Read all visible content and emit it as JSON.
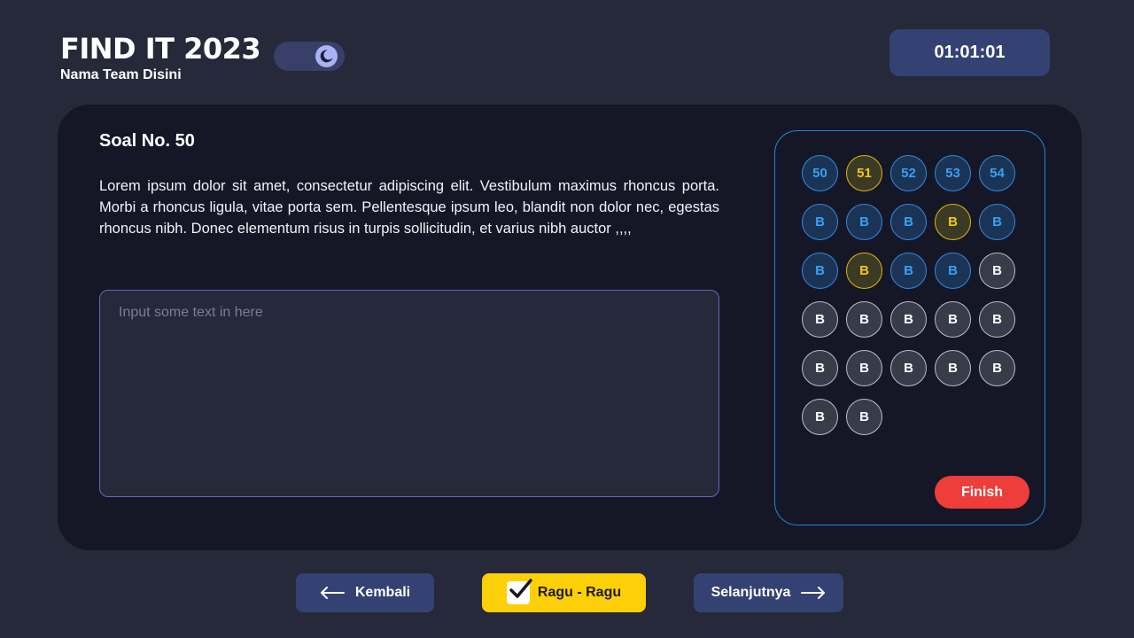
{
  "header": {
    "title": "FIND IT 2023",
    "team_name": "Nama Team Disini",
    "theme_toggle_icon": "moon-icon",
    "timer": "01:01:01"
  },
  "question": {
    "title": "Soal No. 50",
    "text": "Lorem ipsum dolor sit amet, consectetur adipiscing elit. Vestibulum maximus rhoncus porta. Morbi a rhoncus ligula, vitae porta sem. Pellentesque ipsum leo, blandit non dolor nec, egestas rhoncus nibh. Donec elementum risus in turpis sollicitudin, et varius nibh auctor ,,,,",
    "answer_placeholder": "Input some text in here",
    "answer_value": ""
  },
  "navigator": {
    "items": [
      {
        "label": "50",
        "state": "answered"
      },
      {
        "label": "51",
        "state": "doubt"
      },
      {
        "label": "52",
        "state": "answered"
      },
      {
        "label": "53",
        "state": "answered"
      },
      {
        "label": "54",
        "state": "answered"
      },
      {
        "label": "B",
        "state": "answered"
      },
      {
        "label": "B",
        "state": "answered"
      },
      {
        "label": "B",
        "state": "answered"
      },
      {
        "label": "B",
        "state": "doubt"
      },
      {
        "label": "B",
        "state": "answered"
      },
      {
        "label": "B",
        "state": "answered"
      },
      {
        "label": "B",
        "state": "doubt"
      },
      {
        "label": "B",
        "state": "answered"
      },
      {
        "label": "B",
        "state": "answered"
      },
      {
        "label": "B",
        "state": "empty"
      },
      {
        "label": "B",
        "state": "empty"
      },
      {
        "label": "B",
        "state": "empty"
      },
      {
        "label": "B",
        "state": "empty"
      },
      {
        "label": "B",
        "state": "empty"
      },
      {
        "label": "B",
        "state": "empty"
      },
      {
        "label": "B",
        "state": "empty"
      },
      {
        "label": "B",
        "state": "empty"
      },
      {
        "label": "B",
        "state": "empty"
      },
      {
        "label": "B",
        "state": "empty"
      },
      {
        "label": "B",
        "state": "empty"
      },
      {
        "label": "B",
        "state": "empty"
      },
      {
        "label": "B",
        "state": "empty"
      }
    ],
    "finish_label": "Finish"
  },
  "footer": {
    "back_label": "Kembali",
    "back_icon": "arrow-left-icon",
    "doubt_label": "Ragu - Ragu",
    "doubt_checked": true,
    "doubt_icon": "checkmark-icon",
    "next_label": "Selanjutnya",
    "next_icon": "arrow-right-icon"
  },
  "colors": {
    "background": "#252939",
    "card": "#151727",
    "accent_blue": "#36a2f4",
    "doubt_yellow": "#fdcf08",
    "finish_red": "#ee3d3b",
    "button_navy": "#344173"
  }
}
